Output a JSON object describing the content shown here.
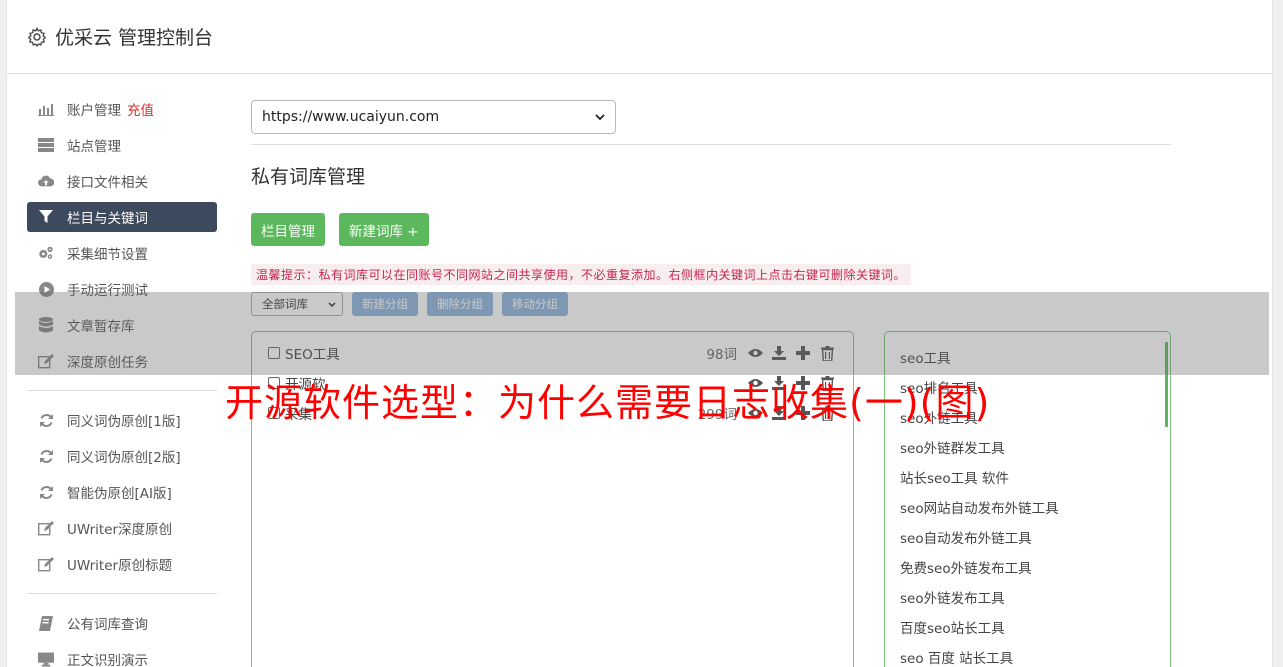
{
  "header": {
    "title": "优采云 管理控制台",
    "icon": "gear-icon"
  },
  "sidebar": {
    "items": [
      {
        "label": "账户管理",
        "extra": "充值",
        "icon": "bar-chart-icon"
      },
      {
        "label": "站点管理",
        "icon": "server-icon"
      },
      {
        "label": "接口文件相关",
        "icon": "cloud-upload-icon"
      },
      {
        "label": "栏目与关键词",
        "icon": "filter-icon",
        "active": true
      },
      {
        "label": "采集细节设置",
        "icon": "cogs-icon"
      },
      {
        "label": "手动运行测试",
        "icon": "play-circle-icon"
      },
      {
        "label": "文章暂存库",
        "icon": "database-icon"
      },
      {
        "label": "深度原创任务",
        "icon": "edit-icon"
      }
    ],
    "items2": [
      {
        "label": "同义词伪原创[1版]",
        "icon": "refresh-icon"
      },
      {
        "label": "同义词伪原创[2版]",
        "icon": "refresh-icon"
      },
      {
        "label": "智能伪原创[AI版]",
        "icon": "refresh-icon"
      },
      {
        "label": "UWriter深度原创",
        "icon": "edit-icon"
      },
      {
        "label": "UWriter原创标题",
        "icon": "edit-icon"
      }
    ],
    "items3": [
      {
        "label": "公有词库查询",
        "icon": "book-icon"
      },
      {
        "label": "正文识别演示",
        "icon": "monitor-icon"
      }
    ]
  },
  "main": {
    "site_select": "https://www.ucaiyun.com",
    "page_title": "私有词库管理",
    "btn_column": "栏目管理",
    "btn_new": "新建词库 +",
    "tip": "温馨提示：私有词库可以在同账号不同网站之间共享使用，不必重复添加。右侧框内关键词上点击右键可删除关键词。",
    "filter_select": "全部词库",
    "btn_new_group": "新建分组",
    "btn_delete_group": "删除分组",
    "btn_move_group": "移动分组"
  },
  "groups": [
    {
      "name": "SEO工具",
      "count": "98词"
    },
    {
      "name": "开源软",
      "count": ""
    },
    {
      "name": "采集",
      "count": "299词"
    }
  ],
  "keywords": [
    "seo工具",
    "seo排名工具",
    "seo外链工具",
    "seo外链群发工具",
    "站长seo工具 软件",
    "seo网站自动发布外链工具",
    "seo自动发布外链工具",
    "免费seo外链发布工具",
    "seo外链发布工具",
    "百度seo站长工具",
    "seo 百度 站长工具"
  ],
  "overlay": {
    "text": "开源软件选型：为什么需要日志收集(一)(图)"
  },
  "colors": {
    "active_nav": "#3d4a5e",
    "green": "#5cb85c",
    "blue_btn": "#8db3dd",
    "tip_text": "#c7254e",
    "overlay_red": "#ff0000"
  }
}
